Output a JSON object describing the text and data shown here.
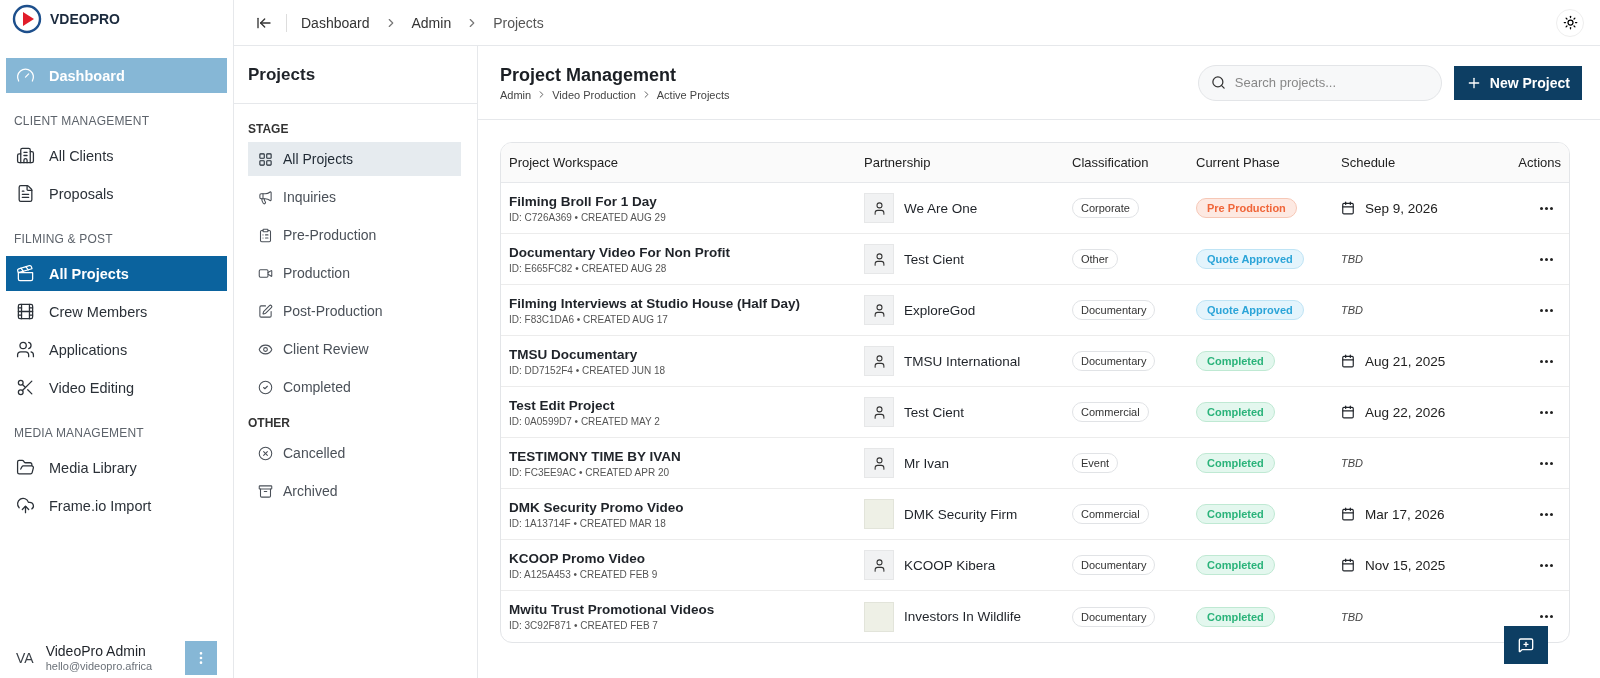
{
  "brand": {
    "name": "VDEOPRO"
  },
  "sidebar": {
    "items": [
      {
        "kind": "link",
        "label": "Dashboard",
        "selected": false,
        "hovered": true
      },
      {
        "kind": "heading",
        "label": "CLIENT MANAGEMENT"
      },
      {
        "kind": "link",
        "label": "All Clients",
        "selected": false,
        "hovered": false
      },
      {
        "kind": "link",
        "label": "Proposals",
        "selected": false,
        "hovered": false
      },
      {
        "kind": "heading",
        "label": "FILMING & POST"
      },
      {
        "kind": "link",
        "label": "All Projects",
        "selected": true,
        "hovered": false
      },
      {
        "kind": "link",
        "label": "Crew Members",
        "selected": false,
        "hovered": false
      },
      {
        "kind": "link",
        "label": "Applications",
        "selected": false,
        "hovered": false
      },
      {
        "kind": "link",
        "label": "Video Editing",
        "selected": false,
        "hovered": false
      },
      {
        "kind": "heading",
        "label": "MEDIA MANAGEMENT"
      },
      {
        "kind": "link",
        "label": "Media Library",
        "selected": false,
        "hovered": false
      },
      {
        "kind": "link",
        "label": "Frame.io Import",
        "selected": false,
        "hovered": false
      }
    ],
    "user": {
      "initials": "VA",
      "name": "VideoPro Admin",
      "email": "hello@videopro.africa"
    }
  },
  "breadcrumb": [
    "Dashboard",
    "Admin",
    "Projects"
  ],
  "filters": {
    "title": "Projects",
    "items": [
      {
        "kind": "heading",
        "label": "STAGE"
      },
      {
        "kind": "link",
        "label": "All Projects",
        "selected": true
      },
      {
        "kind": "link",
        "label": "Inquiries",
        "selected": false
      },
      {
        "kind": "link",
        "label": "Pre-Production",
        "selected": false
      },
      {
        "kind": "link",
        "label": "Production",
        "selected": false
      },
      {
        "kind": "link",
        "label": "Post-Production",
        "selected": false
      },
      {
        "kind": "link",
        "label": "Client Review",
        "selected": false
      },
      {
        "kind": "link",
        "label": "Completed",
        "selected": false
      },
      {
        "kind": "heading",
        "label": "OTHER"
      },
      {
        "kind": "link",
        "label": "Cancelled",
        "selected": false
      },
      {
        "kind": "link",
        "label": "Archived",
        "selected": false
      }
    ]
  },
  "header": {
    "title": "Project Management",
    "trail": [
      "Admin",
      "Video Production",
      "Active Projects"
    ],
    "search": {
      "placeholder": "Search projects..."
    },
    "new_button": "New Project"
  },
  "table": {
    "columns": [
      "Project Workspace",
      "Partnership",
      "Classification",
      "Current Phase",
      "Schedule",
      "Actions"
    ],
    "rows": [
      {
        "name": "Filming Broll For 1 Day",
        "meta": "ID: C726A369 • CREATED AUG 29",
        "partner": {
          "kind": "person",
          "name": "We Are One"
        },
        "classification": "Corporate",
        "phase": {
          "kind": "pre",
          "label": "Pre Production"
        },
        "schedule": {
          "kind": "date",
          "text": "Sep 9, 2026"
        }
      },
      {
        "name": "Documentary Video For Non Profit",
        "meta": "ID: E665FC82 • CREATED AUG 28",
        "partner": {
          "kind": "person",
          "name": "Test Cient"
        },
        "classification": "Other",
        "phase": {
          "kind": "quote",
          "label": "Quote Approved"
        },
        "schedule": {
          "kind": "tbd",
          "text": "TBD"
        }
      },
      {
        "name": "Filming Interviews at Studio House (Half Day)",
        "meta": "ID: F83C1DA6 • CREATED AUG 17",
        "partner": {
          "kind": "person",
          "name": "ExploreGod"
        },
        "classification": "Documentary",
        "phase": {
          "kind": "quote",
          "label": "Quote Approved"
        },
        "schedule": {
          "kind": "tbd",
          "text": "TBD"
        }
      },
      {
        "name": "TMSU Documentary",
        "meta": "ID: DD7152F4 • CREATED JUN 18",
        "partner": {
          "kind": "person",
          "name": "TMSU International"
        },
        "classification": "Documentary",
        "phase": {
          "kind": "done",
          "label": "Completed"
        },
        "schedule": {
          "kind": "date",
          "text": "Aug 21, 2025"
        }
      },
      {
        "name": "Test Edit Project",
        "meta": "ID: 0A0599D7 • CREATED MAY 2",
        "partner": {
          "kind": "person",
          "name": "Test Cient"
        },
        "classification": "Commercial",
        "phase": {
          "kind": "done",
          "label": "Completed"
        },
        "schedule": {
          "kind": "date",
          "text": "Aug 22, 2026"
        }
      },
      {
        "name": "TESTIMONY TIME BY IVAN",
        "meta": "ID: FC3EE9AC • CREATED APR 20",
        "partner": {
          "kind": "person",
          "name": "Mr Ivan"
        },
        "classification": "Event",
        "phase": {
          "kind": "done",
          "label": "Completed"
        },
        "schedule": {
          "kind": "tbd",
          "text": "TBD"
        }
      },
      {
        "name": "DMK Security Promo Video",
        "meta": "ID: 1A13714F • CREATED MAR 18",
        "partner": {
          "kind": "logo",
          "name": "DMK Security Firm"
        },
        "classification": "Commercial",
        "phase": {
          "kind": "done",
          "label": "Completed"
        },
        "schedule": {
          "kind": "date",
          "text": "Mar 17, 2026"
        }
      },
      {
        "name": "KCOOP Promo Video",
        "meta": "ID: A125A453 • CREATED FEB 9",
        "partner": {
          "kind": "person",
          "name": "KCOOP Kibera"
        },
        "classification": "Documentary",
        "phase": {
          "kind": "done",
          "label": "Completed"
        },
        "schedule": {
          "kind": "date",
          "text": "Nov 15, 2025"
        }
      },
      {
        "name": "Mwitu Trust Promotional Videos",
        "meta": "ID: 3C92F871 • CREATED FEB 7",
        "partner": {
          "kind": "logo",
          "name": "Investors In Wildlife"
        },
        "classification": "Documentary",
        "phase": {
          "kind": "done",
          "label": "Completed"
        },
        "schedule": {
          "kind": "tbd",
          "text": "TBD"
        }
      }
    ]
  }
}
